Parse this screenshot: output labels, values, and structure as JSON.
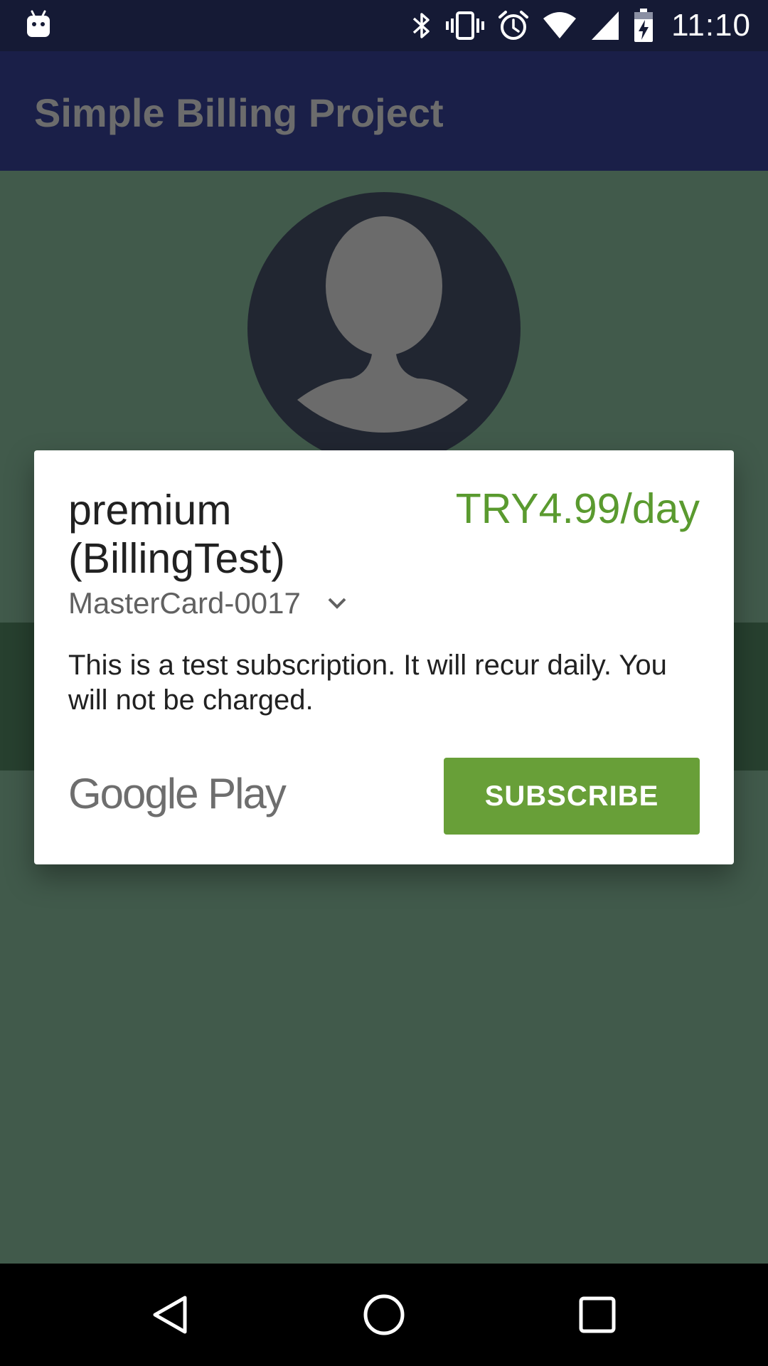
{
  "status_bar": {
    "time": "11:10",
    "icons": [
      "android-debug-icon",
      "bluetooth-icon",
      "vibrate-icon",
      "alarm-icon",
      "wifi-icon",
      "cell-signal-icon",
      "battery-charging-icon"
    ]
  },
  "app_bar": {
    "title": "Simple Billing Project"
  },
  "dialog": {
    "product_name": "premium (BillingTest)",
    "price": "TRY4.99/day",
    "payment_method": "MasterCard-0017",
    "description": "This is a test subscription. It will recur daily. You will not be charged.",
    "brand": "Google Play",
    "subscribe_label": "SUBSCRIBE"
  },
  "nav_bar": {
    "buttons": [
      "back-icon",
      "home-icon",
      "recents-icon"
    ]
  },
  "colors": {
    "status_bar": "#151a35",
    "app_bar": "#1a1f48",
    "content_background": "#415a4b",
    "price": "#5a9a2f",
    "subscribe_button": "#689f38"
  }
}
